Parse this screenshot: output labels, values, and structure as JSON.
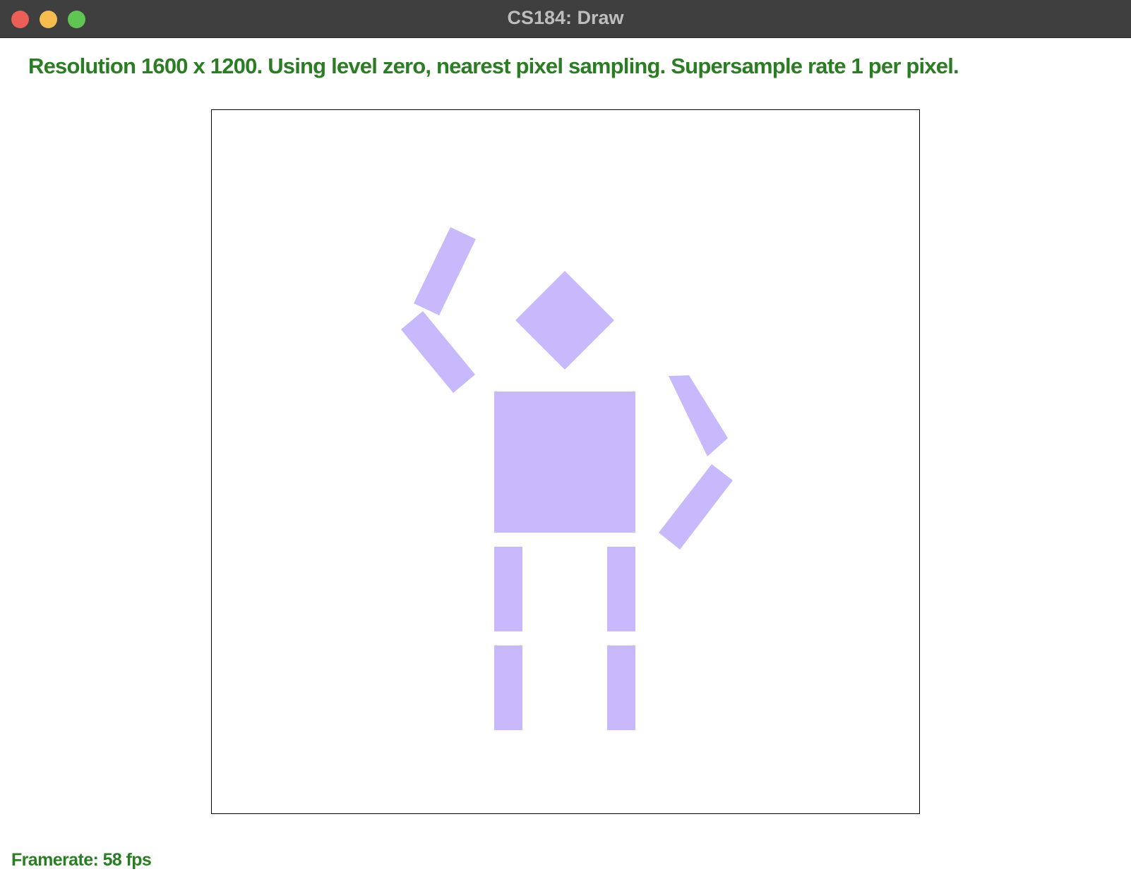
{
  "window": {
    "title": "CS184: Draw",
    "controls": {
      "close_color": "#ec5f57",
      "minimize_color": "#f5be4f",
      "zoom_color": "#61c554"
    }
  },
  "status": {
    "text": "Resolution 1600 x 1200. Using level zero, nearest pixel sampling. Supersample rate 1 per pixel.",
    "color": "#2a7d22"
  },
  "canvas": {
    "background": "#ffffff",
    "border_color": "#000000",
    "fill_color": "#c8b8fc"
  },
  "footer": {
    "framerate_text": "Framerate: 58 fps",
    "color": "#2a7d22"
  }
}
